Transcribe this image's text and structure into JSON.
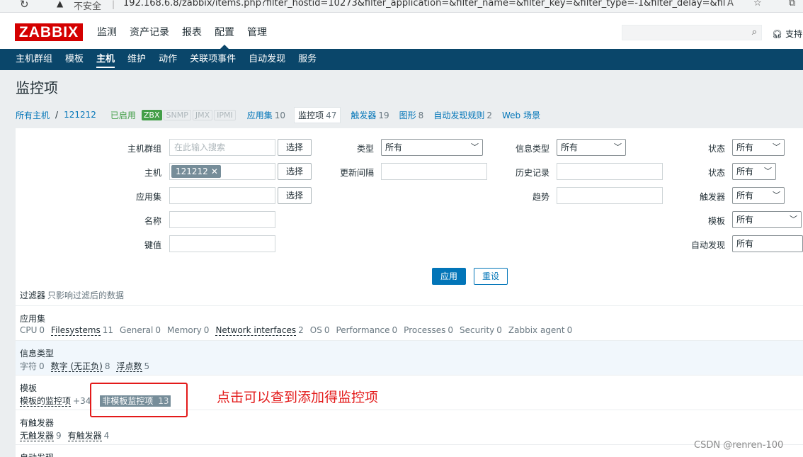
{
  "browser": {
    "insecure_label": "不安全",
    "url": "192.168.6.8/zabbix/items.php?filter_hostid=10273&filter_application=&filter_name=&filter_key=&filter_type=-1&filter_delay=&filter_s..."
  },
  "header": {
    "logo": "ZABBIX",
    "menu": [
      "监测",
      "资产记录",
      "报表",
      "配置",
      "管理"
    ],
    "active_menu": "配置",
    "support": "支持"
  },
  "subnav": {
    "items": [
      "主机群组",
      "模板",
      "主机",
      "维护",
      "动作",
      "关联项事件",
      "自动发现",
      "服务"
    ],
    "active": "主机"
  },
  "page": {
    "title": "监控项"
  },
  "hostnav": {
    "all_hosts": "所有主机",
    "separator": "/",
    "host": "121212",
    "status": "已启用",
    "tags": [
      "ZBX",
      "SNMP",
      "JMX",
      "IPMI"
    ],
    "applications": {
      "label": "应用集",
      "count": "10"
    },
    "items": {
      "label": "监控项",
      "count": "47"
    },
    "triggers": {
      "label": "触发器",
      "count": "19"
    },
    "graphs": {
      "label": "图形",
      "count": "8"
    },
    "discovery": {
      "label": "自动发现规则",
      "count": "2"
    },
    "web": {
      "label": "Web 场景"
    }
  },
  "filter": {
    "host_group_label": "主机群组",
    "host_group_placeholder": "在此输入搜索",
    "select_label": "选择",
    "host_label": "主机",
    "host_chip": "121212",
    "host_chip_remove": "✕",
    "application_label": "应用集",
    "name_label": "名称",
    "key_label": "键值",
    "type_label": "类型",
    "type_value": "所有",
    "interval_label": "更新间隔",
    "info_type_label": "信息类型",
    "info_type_value": "所有",
    "history_label": "历史记录",
    "trends_label": "趋势",
    "state_label": "状态",
    "state_value": "所有",
    "status_label": "状态",
    "status_value": "所有",
    "triggers_label": "触发器",
    "triggers_value": "所有",
    "template_label": "模板",
    "template_value": "所有",
    "discovery_label": "自动发现",
    "discovery_value": "所有",
    "apply": "应用",
    "reset": "重设",
    "note_title": "过滤器",
    "note_sub": "只影响过滤后的数据"
  },
  "subfilters": {
    "applications": {
      "title": "应用集",
      "items": [
        {
          "label": "CPU",
          "count": "0",
          "has": false
        },
        {
          "label": "Filesystems",
          "count": "11",
          "has": true
        },
        {
          "label": "General",
          "count": "0",
          "has": false
        },
        {
          "label": "Memory",
          "count": "0",
          "has": false
        },
        {
          "label": "Network interfaces",
          "count": "2",
          "has": true
        },
        {
          "label": "OS",
          "count": "0",
          "has": false
        },
        {
          "label": "Performance",
          "count": "0",
          "has": false
        },
        {
          "label": "Processes",
          "count": "0",
          "has": false
        },
        {
          "label": "Security",
          "count": "0",
          "has": false
        },
        {
          "label": "Zabbix agent",
          "count": "0",
          "has": false
        }
      ]
    },
    "info_types": {
      "title": "信息类型",
      "items": [
        {
          "label": "字符",
          "count": "0",
          "has": false
        },
        {
          "label": "数字 (无正负)",
          "count": "8",
          "has": true
        },
        {
          "label": "浮点数",
          "count": "5",
          "has": true
        }
      ]
    },
    "templates": {
      "title": "模板",
      "items": [
        {
          "label": "模板的监控项",
          "count": "+34",
          "has": true
        },
        {
          "label": "非模板监控项",
          "count": "13",
          "has": true,
          "selected": true
        }
      ]
    },
    "with_triggers": {
      "title": "有触发器",
      "items": [
        {
          "label": "无触发器",
          "count": "9",
          "has": true
        },
        {
          "label": "有触发器",
          "count": "4",
          "has": true
        }
      ]
    },
    "discovery": {
      "title": "自动发现"
    }
  },
  "annotation": {
    "text": "点击可以查到添加得监控项"
  },
  "watermark": "CSDN @renren-100"
}
